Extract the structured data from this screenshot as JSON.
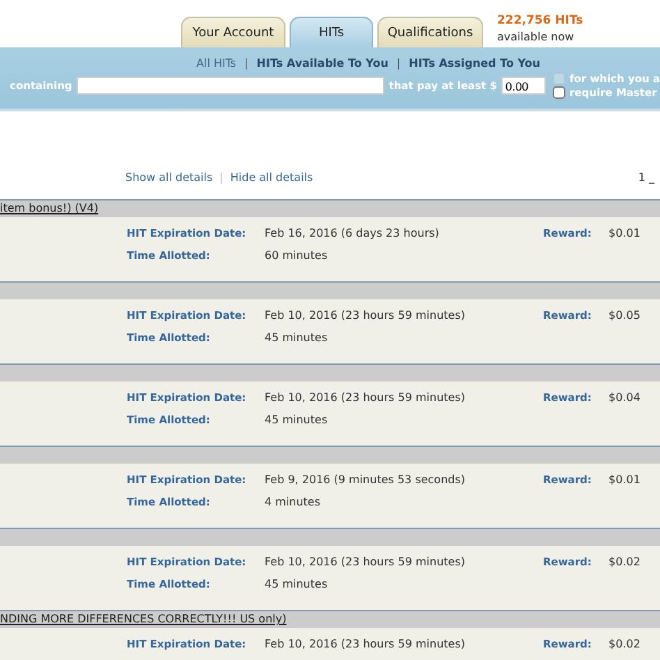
{
  "tabs": [
    {
      "label": "Your Account",
      "selected": false
    },
    {
      "label": "HITs",
      "selected": true
    },
    {
      "label": "Qualifications",
      "selected": false
    }
  ],
  "hit_count": {
    "count": "222,756 HITs",
    "caption": "available now"
  },
  "nav": [
    {
      "label": "All HITs",
      "selected": true
    },
    {
      "label": "HITs Available To You",
      "selected": false
    },
    {
      "label": "HITs Assigned To You",
      "selected": false
    }
  ],
  "nav_separator": "|",
  "search": {
    "label": "containing",
    "pay_label": "that pay at least $",
    "min_pay": "0.00",
    "options": [
      {
        "label": "for which you a",
        "checked": false,
        "disabled": true
      },
      {
        "label": "require Master",
        "checked": false,
        "disabled": false
      }
    ]
  },
  "details_links": [
    {
      "label": "Show all details"
    },
    {
      "label": "Hide all details"
    }
  ],
  "details_separator": "|",
  "pager": "1 _",
  "hits": [
    {
      "title": "item bonus!) (V4)",
      "expiration_label": "HIT Expiration Date:",
      "expiration": "Feb 16, 2016  (6 days 23 hours)",
      "reward_label": "Reward:",
      "reward": "$0.01",
      "time_label": "Time Allotted:",
      "time": "60 minutes"
    },
    {
      "expiration_label": "HIT Expiration Date:",
      "expiration": "Feb 10, 2016  (23 hours 59 minutes)",
      "reward_label": "Reward:",
      "reward": "$0.05",
      "time_label": "Time Allotted:",
      "time": "45 minutes"
    },
    {
      "expiration_label": "HIT Expiration Date:",
      "expiration": "Feb 10, 2016  (23 hours 59 minutes)",
      "reward_label": "Reward:",
      "reward": "$0.04",
      "time_label": "Time Allotted:",
      "time": "45 minutes"
    },
    {
      "expiration_label": "HIT Expiration Date:",
      "expiration": "Feb 9, 2016  (9 minutes 53 seconds)",
      "reward_label": "Reward:",
      "reward": "$0.01",
      "time_label": "Time Allotted:",
      "time": "4 minutes"
    },
    {
      "expiration_label": "HIT Expiration Date:",
      "expiration": "Feb 10, 2016  (23 hours 59 minutes)",
      "reward_label": "Reward:",
      "reward": "$0.02",
      "time_label": "Time Allotted:",
      "time": "45 minutes"
    },
    {
      "title": "NDING MORE DIFFERENCES CORRECTLY!!! US only)",
      "expiration_label": "HIT Expiration Date:",
      "expiration": "Feb 10, 2016  (23 hours 59 minutes)",
      "reward_label": "Reward:",
      "reward": "$0.02"
    }
  ]
}
